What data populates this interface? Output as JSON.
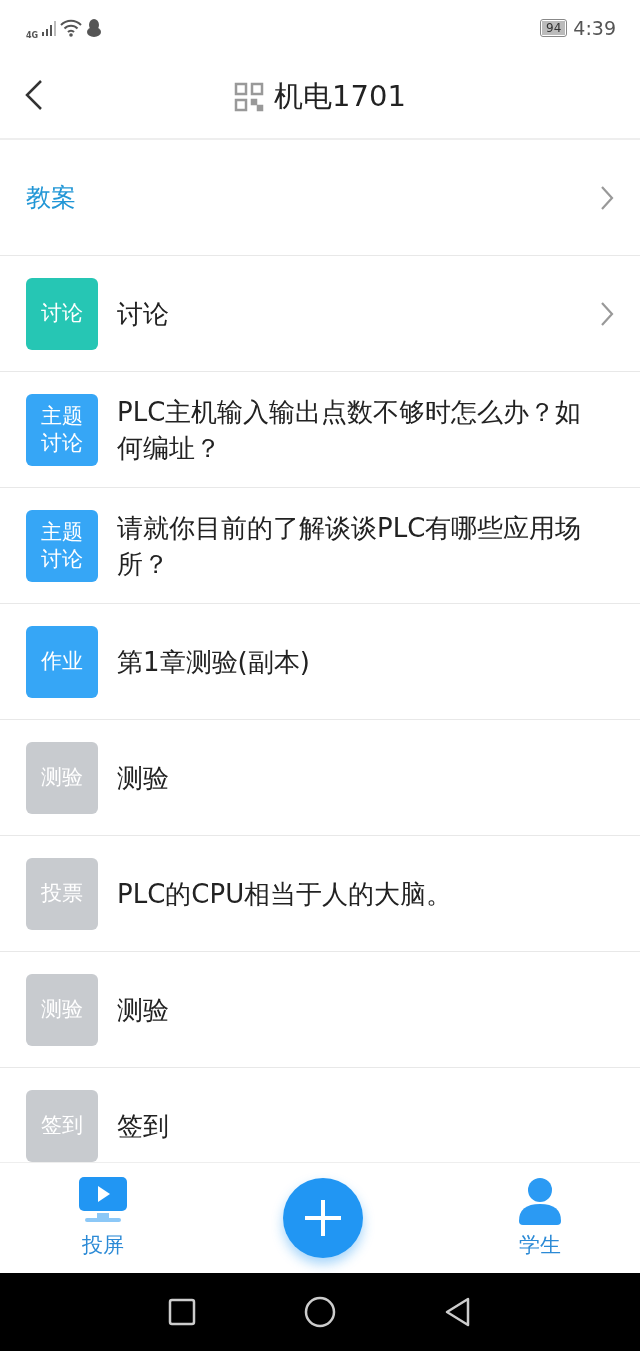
{
  "status_bar": {
    "network": "4G",
    "battery": "94",
    "time": "4:39"
  },
  "header": {
    "title": "机电1701"
  },
  "lesson_plan": {
    "label": "教案"
  },
  "items": [
    {
      "badge": "讨论",
      "color": "#26c6b4",
      "title": "讨论",
      "arrow": true
    },
    {
      "badge": "主题讨论",
      "color": "#36a6f6",
      "title": "PLC主机输入输出点数不够时怎么办？如何编址？",
      "arrow": false
    },
    {
      "badge": "主题讨论",
      "color": "#36a6f6",
      "title": "请就你目前的了解谈谈PLC有哪些应用场所？",
      "arrow": false
    },
    {
      "badge": "作业",
      "color": "#36a6f6",
      "title": "第1章测验(副本)",
      "arrow": false
    },
    {
      "badge": "测验",
      "color": "#c8cbcf",
      "title": "测验",
      "arrow": false
    },
    {
      "badge": "投票",
      "color": "#c8cbcf",
      "title": "PLC的CPU相当于人的大脑。",
      "arrow": false
    },
    {
      "badge": "测验",
      "color": "#c8cbcf",
      "title": "测验",
      "arrow": false
    },
    {
      "badge": "签到",
      "color": "#c8cbcf",
      "title": "签到",
      "arrow": false
    }
  ],
  "bottom_bar": {
    "left": "投屏",
    "right": "学生"
  }
}
